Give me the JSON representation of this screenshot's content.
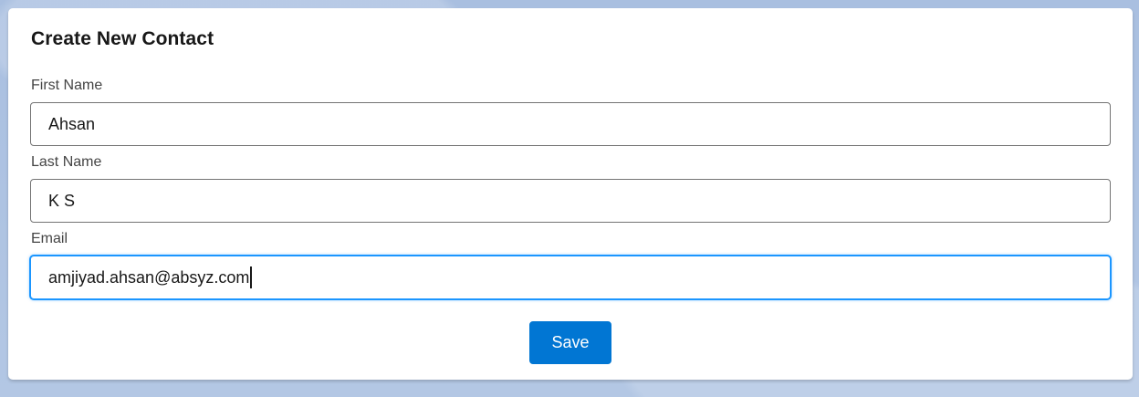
{
  "form": {
    "title": "Create New Contact",
    "fields": {
      "first_name": {
        "label": "First Name",
        "value": "Ahsan"
      },
      "last_name": {
        "label": "Last Name",
        "value": "K S"
      },
      "email": {
        "label": "Email",
        "value": "amjiyad.ahsan@absyz.com"
      }
    },
    "save_label": "Save"
  },
  "colors": {
    "background": "#b0c4de",
    "primary_button": "#0176d3",
    "focus_ring": "#1b96ff"
  }
}
